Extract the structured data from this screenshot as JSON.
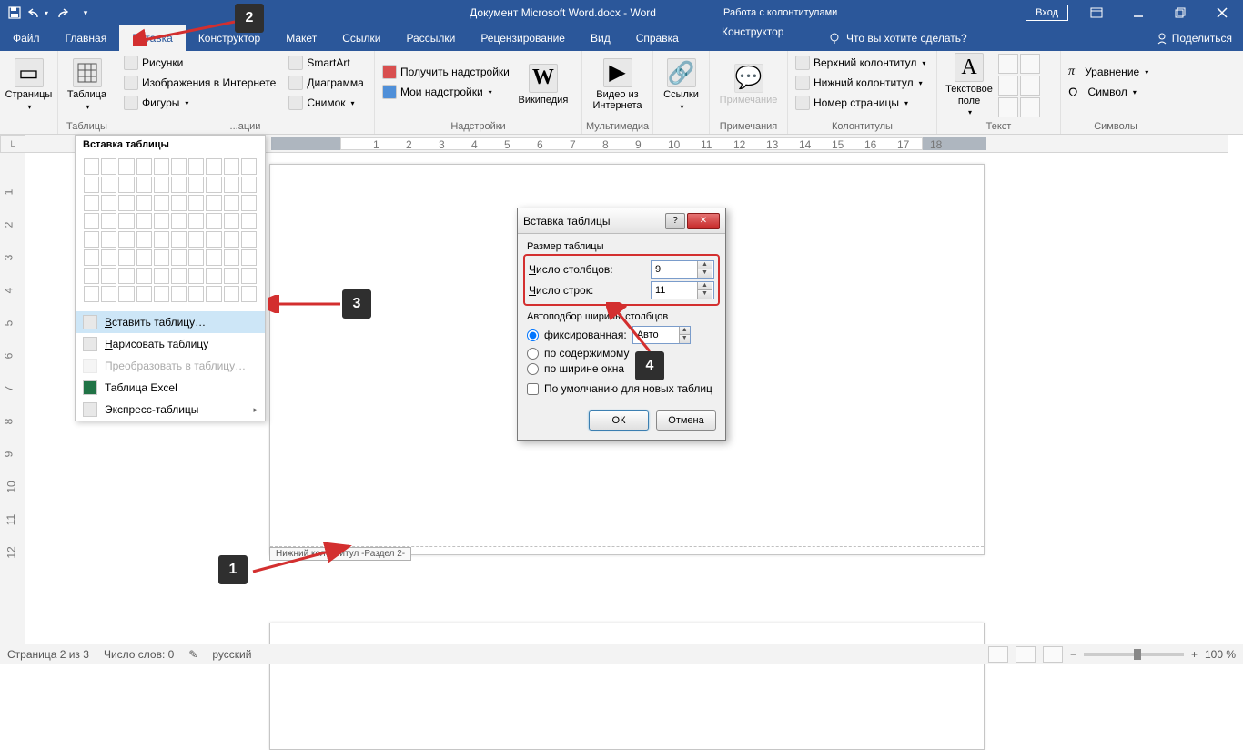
{
  "title": "Документ Microsoft Word.docx - Word",
  "contextual_tab_title": "Работа с колонтитулами",
  "login": "Вход",
  "tabs": {
    "file": "Файл",
    "home": "Главная",
    "insert": "Вставка",
    "design": "Конструктор",
    "layout": "Макет",
    "references": "Ссылки",
    "mailings": "Рассылки",
    "review": "Рецензирование",
    "view": "Вид",
    "help": "Справка",
    "hf_design": "Конструктор",
    "tellme": "Что вы хотите сделать?",
    "share": "Поделиться"
  },
  "ribbon": {
    "pages": {
      "btn": "Страницы"
    },
    "tables": {
      "btn": "Таблица",
      "group": "Таблицы"
    },
    "illustrations": {
      "pictures": "Рисунки",
      "online_pictures": "Изображения в Интернете",
      "shapes": "Фигуры",
      "smartart": "SmartArt",
      "chart": "Диаграмма",
      "screenshot": "Снимок",
      "group": "...ации"
    },
    "addins": {
      "get": "Получить надстройки",
      "my": "Мои надстройки",
      "wiki": "Википедия",
      "group": "Надстройки"
    },
    "media": {
      "video": "Видео из Интернета",
      "group": "Мультимедиа"
    },
    "links": {
      "btn": "Ссылки"
    },
    "comments": {
      "btn": "Примечание",
      "group": "Примечания"
    },
    "hf": {
      "header": "Верхний колонтитул",
      "footer": "Нижний колонтитул",
      "page_num": "Номер страницы",
      "group": "Колонтитулы"
    },
    "text": {
      "textbox": "Текстовое поле",
      "group": "Текст"
    },
    "symbols": {
      "equation": "Уравнение",
      "symbol": "Символ",
      "group": "Символы"
    }
  },
  "table_menu": {
    "header": "Вставка таблицы",
    "insert": "Вставить таблицу…",
    "draw": "Нарисовать таблицу",
    "convert": "Преобразовать в таблицу…",
    "excel": "Таблица Excel",
    "quick": "Экспресс-таблицы"
  },
  "dialog": {
    "title": "Вставка таблицы",
    "size_label": "Размер таблицы",
    "cols_label": "Число столбцов:",
    "cols_value": "9",
    "rows_label": "Число строк:",
    "rows_value": "11",
    "autofit_label": "Автоподбор ширины столбцов",
    "fixed": "фиксированная:",
    "fixed_value": "Авто",
    "by_content": "по содержимому",
    "by_window": "по ширине окна",
    "remember": "По умолчанию для новых таблиц",
    "ok": "ОК",
    "cancel": "Отмена"
  },
  "footer_tag": "Нижний колонтитул -Раздел 2-",
  "status": {
    "page": "Страница 2 из 3",
    "words": "Число слов: 0",
    "lang": "русский",
    "zoom": "100 %"
  },
  "callouts": {
    "c1": "1",
    "c2": "2",
    "c3": "3",
    "c4": "4"
  }
}
